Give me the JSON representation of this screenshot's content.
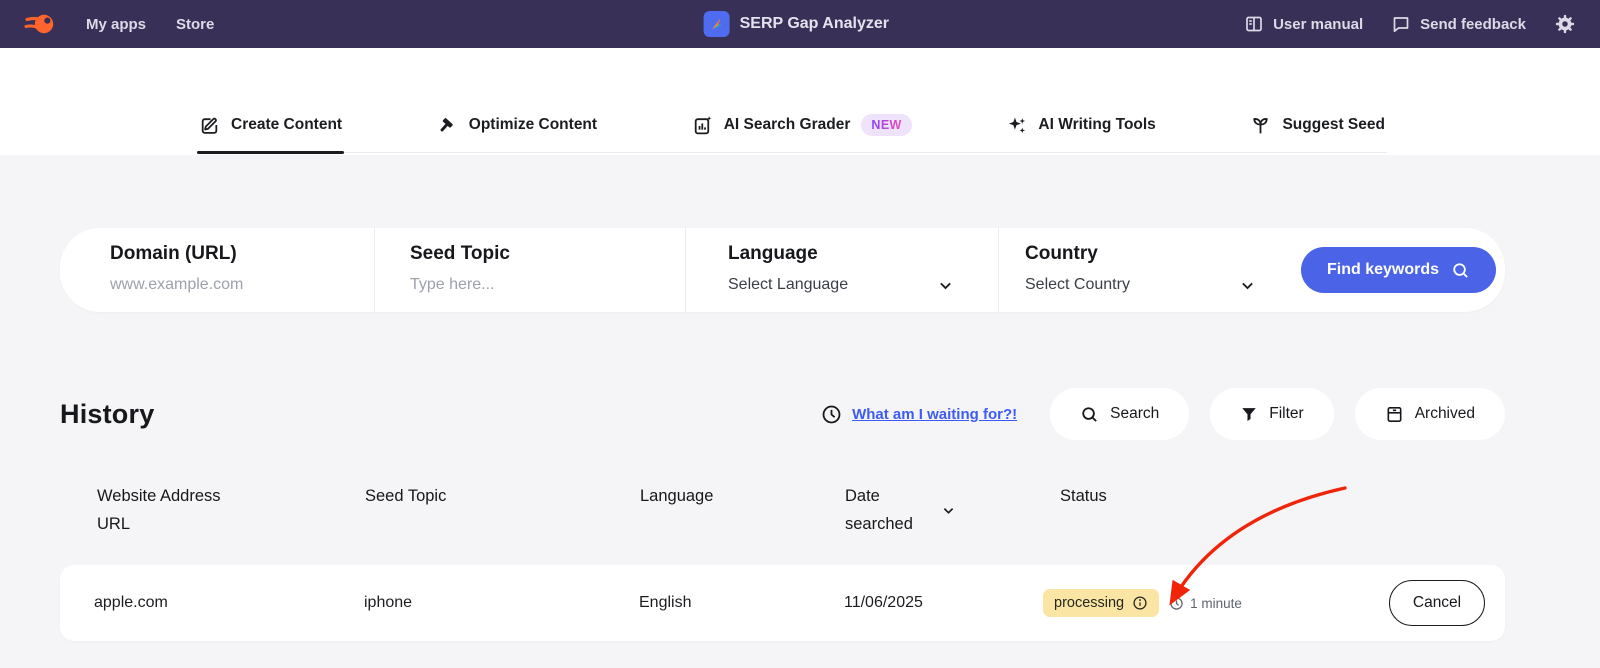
{
  "navbar": {
    "items_left": [
      {
        "label": "My apps"
      },
      {
        "label": "Store"
      }
    ],
    "app": {
      "title": "SERP Gap Analyzer"
    },
    "items_right": [
      {
        "label": "User manual"
      },
      {
        "label": "Send feedback"
      }
    ]
  },
  "tabs": [
    {
      "label": "Create Content",
      "icon": "edit-icon",
      "active": true
    },
    {
      "label": "Optimize Content",
      "icon": "hammer-icon",
      "active": false
    },
    {
      "label": "AI Search Grader",
      "icon": "grader-chart-icon",
      "badge": "NEW",
      "active": false
    },
    {
      "label": "AI Writing Tools",
      "icon": "sparkles-icon",
      "active": false
    },
    {
      "label": "Suggest Seed",
      "icon": "seedling-icon",
      "active": false
    }
  ],
  "form": {
    "fields": [
      {
        "label": "Domain (URL)",
        "placeholder": "www.example.com"
      },
      {
        "label": "Seed Topic",
        "placeholder": "Type here..."
      },
      {
        "label": "Language",
        "value": "Select Language"
      },
      {
        "label": "Country",
        "value": "Select Country"
      }
    ],
    "submit_label": "Find keywords"
  },
  "history": {
    "title": "History",
    "waiting_link": "What am I waiting for?!",
    "actions": [
      {
        "label": "Search",
        "icon": "search-icon"
      },
      {
        "label": "Filter",
        "icon": "filter-icon"
      },
      {
        "label": "Archived",
        "icon": "archive-icon"
      }
    ],
    "table": {
      "columns": [
        "Website Address URL",
        "Seed Topic",
        "Language",
        "Date searched",
        "Status"
      ],
      "rows": [
        {
          "website_url": "apple.com",
          "seed_topic": "iphone",
          "language": "English",
          "date_searched": "11/06/2025",
          "status": "processing",
          "elapsed": "1 minute",
          "action_label": "Cancel"
        }
      ]
    }
  },
  "colors": {
    "navbar_bg": "#383057",
    "brand_orange": "#FF642D",
    "accent_blue": "#4A63E7",
    "link_blue": "#3D5BF5",
    "new_badge_bg": "#EFE3FB",
    "new_badge_gradient": [
      "#8A3FFC",
      "#E84FB4"
    ],
    "processing_badge_bg": "#FAE5A4",
    "annotation_red": "#EF2409",
    "page_bg": "#F5F5F7"
  }
}
